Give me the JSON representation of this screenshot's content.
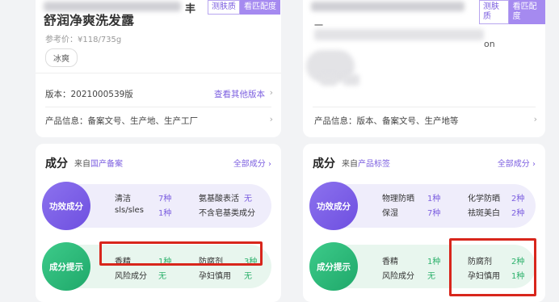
{
  "left": {
    "badges": [
      "测肤质",
      "看匹配度"
    ],
    "product_name": "舒润净爽洗发露",
    "price": "参考价：¥118/735g",
    "tag": "冰爽",
    "version_label": "版本：2021000539版",
    "version_link": "查看其他版本",
    "info_label": "产品信息：备案文号、生产地、生产工厂",
    "section": {
      "title": "成分",
      "source_prefix": "来自",
      "source_link": "国产备案",
      "all_link": "全部成分"
    },
    "efficacy": {
      "label": "功效成分",
      "items": [
        {
          "name": "清洁",
          "count": "7种"
        },
        {
          "name": "sls/sles",
          "count": "1种"
        },
        {
          "name": "氨基酸表活",
          "count": "无"
        },
        {
          "name": "不含皂基类成分",
          "count": ""
        }
      ]
    },
    "hints": {
      "label": "成分提示",
      "items": [
        {
          "name": "香精",
          "count": "1种"
        },
        {
          "name": "风险成分",
          "count": "无"
        },
        {
          "name": "防腐剂",
          "count": "3种"
        },
        {
          "name": "孕妇慎用",
          "count": "无"
        }
      ]
    }
  },
  "right": {
    "badges": [
      "测肤质",
      "看匹配度"
    ],
    "title_fragment": "一",
    "partial_text": "on",
    "info_label": "产品信息：版本、备案文号、生产地等",
    "section": {
      "title": "成分",
      "source_prefix": "来自",
      "source_link": "产品标签",
      "all_link": "全部成分"
    },
    "efficacy": {
      "label": "功效成分",
      "items": [
        {
          "name": "物理防晒",
          "count": "1种"
        },
        {
          "name": "保湿",
          "count": "7种"
        },
        {
          "name": "化学防晒",
          "count": "2种"
        },
        {
          "name": "祛斑美白",
          "count": "2种"
        }
      ]
    },
    "hints": {
      "label": "成分提示",
      "items": [
        {
          "name": "香精",
          "count": "1种"
        },
        {
          "name": "风险成分",
          "count": "无"
        },
        {
          "name": "防腐剂",
          "count": "2种"
        },
        {
          "name": "孕妇慎用",
          "count": "1种"
        }
      ]
    }
  },
  "colors": {
    "accent_purple": "#7d60e0",
    "accent_green": "#2fb26d",
    "highlight_red": "#d8261c"
  }
}
